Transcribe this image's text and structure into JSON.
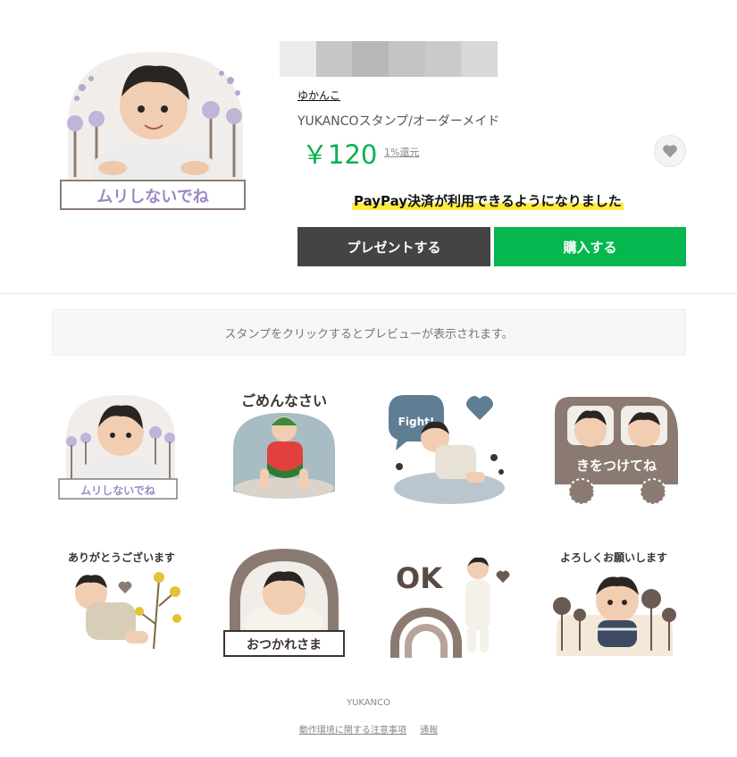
{
  "product": {
    "author": "ゆかんこ",
    "name": "YUKANCOスタンプ/オーダーメイド",
    "price": "￥120",
    "cashback": "1%還元",
    "paypay_notice": "PayPay決済が利用できるようになりました",
    "gift_button": "プレゼントする",
    "buy_button": "購入する",
    "main_caption": "ムリしないでね"
  },
  "preview_notice": "スタンプをクリックするとプレビューが表示されます。",
  "stickers": [
    {
      "caption": "ムリしないでね"
    },
    {
      "caption": "ごめんなさい"
    },
    {
      "caption": "Fight!"
    },
    {
      "caption": "きをつけてね"
    },
    {
      "caption": "ありがとうございます"
    },
    {
      "caption": "おつかれさま"
    },
    {
      "caption": "OK"
    },
    {
      "caption": "よろしくお願いします"
    }
  ],
  "footer": {
    "brand": "YUKANCO",
    "links": [
      "動作環境に関する注意事項",
      "通報"
    ]
  },
  "colors": {
    "accent_green": "#06b74f",
    "price_green": "#06b050",
    "gift_button": "#444444",
    "highlight_yellow": "#ffeb3b"
  },
  "icons": [
    "heart-icon"
  ]
}
